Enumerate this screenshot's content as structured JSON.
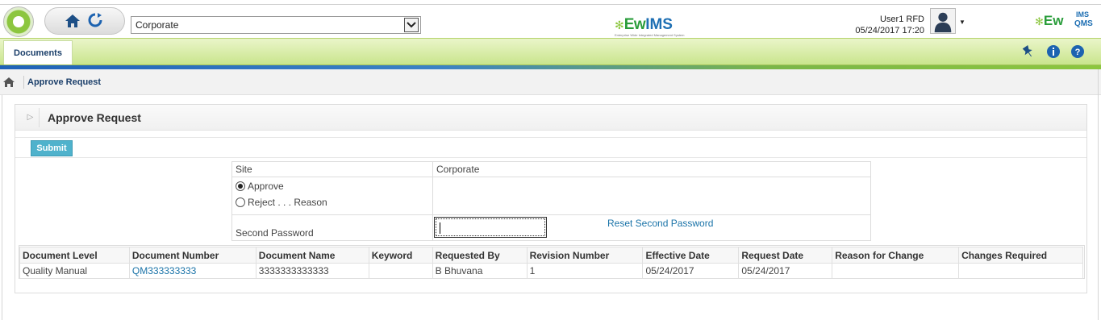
{
  "header": {
    "site_value": "Corporate",
    "center_logo": {
      "ew": "Ew",
      "ims": "IMS",
      "tagline": "Enterprise Wide Integrated Management System"
    },
    "user_name": "User1 RFD",
    "user_datetime": "05/24/2017 17:20",
    "right_logo": {
      "ew": "Ew",
      "ims": "IMS",
      "qms": "QMS"
    }
  },
  "nav": {
    "documents_tab": "Documents"
  },
  "breadcrumb": {
    "current": "Approve Request"
  },
  "panel": {
    "title": "Approve Request",
    "submit_label": "Submit",
    "form": {
      "site_label": "Site",
      "site_value": "Corporate",
      "approve_label": "Approve",
      "reject_label": "Reject . . . Reason",
      "second_password_label": "Second Password",
      "reset_link": "Reset Second Password",
      "selected_option": "Approve"
    },
    "grid": {
      "columns": [
        "Document Level",
        "Document Number",
        "Document Name",
        "Keyword",
        "Requested By",
        "Revision Number",
        "Effective Date",
        "Request Date",
        "Reason for Change",
        "Changes Required"
      ],
      "rows": [
        [
          "Quality Manual",
          "QM333333333",
          "3333333333333",
          "",
          "B Bhuvana",
          "1",
          "05/24/2017",
          "05/24/2017",
          "",
          ""
        ]
      ]
    }
  },
  "colors": {
    "accent_green": "#8cc63f",
    "brand_blue": "#1b3f6a",
    "link_blue": "#1a73a8",
    "submit_bg": "#4fb2cc"
  }
}
